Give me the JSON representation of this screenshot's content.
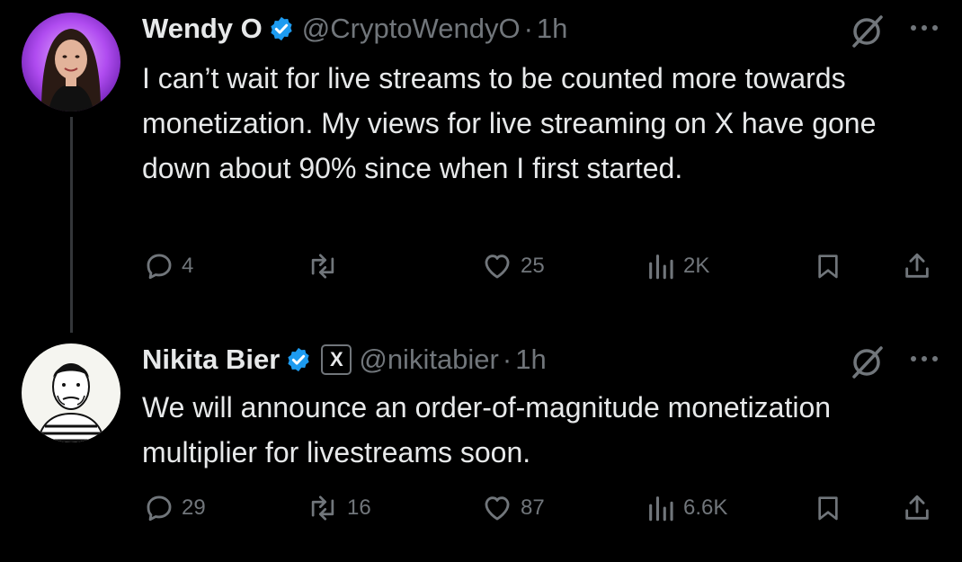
{
  "tweets": [
    {
      "name": "Wendy O",
      "handle": "@CryptoWendyO",
      "separator": "·",
      "time": "1h",
      "text": "I can’t wait for live streams to be counted more towards monetization. My views for live streaming on X have gone down about 90% since when I first started.",
      "actions": {
        "replies": "4",
        "reposts": "",
        "likes": "25",
        "views": "2K"
      },
      "avatar": "avatar-woman-purple-background"
    },
    {
      "name": "Nikita Bier",
      "handle": "@nikitabier",
      "separator": "·",
      "time": "1h",
      "affiliation_badge": "X",
      "text": "We will announce an order-of-magnitude monetization multiplier for livestreams soon.",
      "actions": {
        "replies": "29",
        "reposts": "16",
        "likes": "87",
        "views": "6.6K"
      },
      "avatar": "avatar-sketch-man"
    }
  ],
  "icons": [
    "verified-badge-icon",
    "grok-icon",
    "more-icon",
    "reply-icon",
    "repost-icon",
    "like-icon",
    "views-icon",
    "bookmark-icon",
    "share-icon"
  ],
  "colors": {
    "background": "#000000",
    "text": "#e7e9ea",
    "muted": "#71767b",
    "verified": "#1d9bf0",
    "avatar_bg": "#a855f7"
  }
}
